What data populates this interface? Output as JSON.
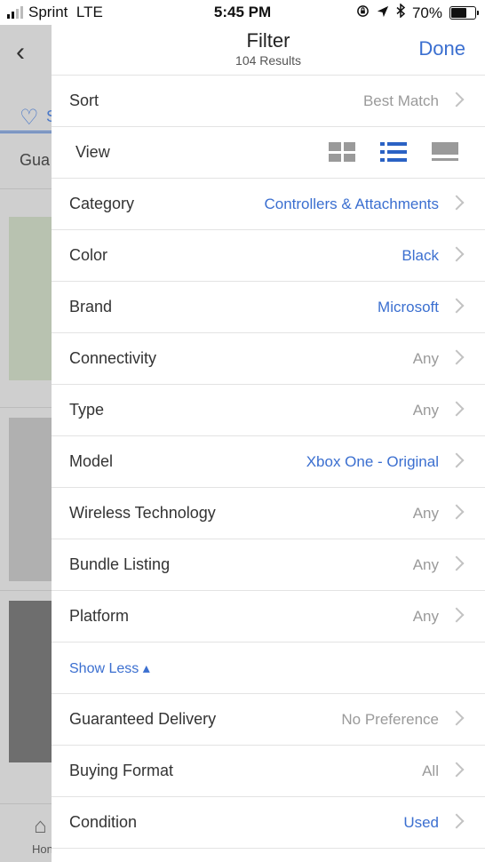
{
  "status_bar": {
    "carrier": "Sprint",
    "network": "LTE",
    "time": "5:45 PM",
    "battery_percent": "70%",
    "battery_level": 0.7,
    "icons": [
      "orientation-lock-icon",
      "location-arrow-icon",
      "bluetooth-icon"
    ]
  },
  "background": {
    "tab_label_fragment": "S",
    "filter_chip_fragment": "Gua",
    "home_label_fragment": "Hon"
  },
  "header": {
    "title": "Filter",
    "subtitle": "104 Results",
    "done_label": "Done"
  },
  "rows": {
    "sort": {
      "label": "Sort",
      "value": "Best Match"
    },
    "view": {
      "label": "View",
      "options": [
        "grid-view-icon",
        "list-view-icon",
        "gallery-view-icon"
      ],
      "selected": "list-view-icon"
    },
    "category": {
      "label": "Category",
      "value": "Controllers & Attachments"
    },
    "color": {
      "label": "Color",
      "value": "Black"
    },
    "brand": {
      "label": "Brand",
      "value": "Microsoft"
    },
    "connectivity": {
      "label": "Connectivity",
      "value": "Any"
    },
    "type": {
      "label": "Type",
      "value": "Any"
    },
    "model": {
      "label": "Model",
      "value": "Xbox One - Original"
    },
    "wireless": {
      "label": "Wireless Technology",
      "value": "Any"
    },
    "bundle": {
      "label": "Bundle Listing",
      "value": "Any"
    },
    "platform": {
      "label": "Platform",
      "value": "Any"
    },
    "show_less": {
      "label": "Show Less ▴"
    },
    "delivery": {
      "label": "Guaranteed Delivery",
      "value": "No Preference"
    },
    "buying_format": {
      "label": "Buying Format",
      "value": "All"
    },
    "condition": {
      "label": "Condition",
      "value": "Used"
    }
  },
  "colors": {
    "accent": "#3b6fd0",
    "muted_value": "#9a9a9a",
    "overlay": "#cfcfcf"
  }
}
